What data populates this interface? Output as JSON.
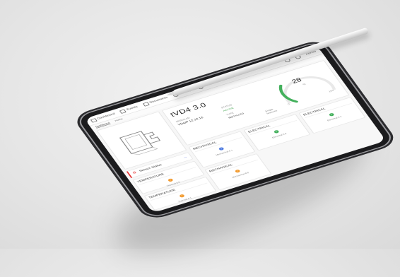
{
  "topbar": {
    "nav": [
      "Dashboard",
      "Events",
      "Documents",
      "Settings",
      "More information"
    ],
    "user": "Admin"
  },
  "subnav": [
    "Dashboard",
    "Home"
  ],
  "machine": {
    "name": "tVD4 3.0",
    "label_a": "SERIAL/ID",
    "value_a": "VD4/P 12.12.16",
    "label_b": "STATUS",
    "value_b": "ACTIVE",
    "label_c": "TYPE",
    "value_c": "INSTALLED",
    "right_note": "Single features"
  },
  "gauge": {
    "value": "28",
    "unit": "%",
    "min": "0",
    "max": "100",
    "fraction": 0.28
  },
  "sensor": {
    "label": "Sensor Status"
  },
  "tiles": [
    {
      "name": "TEMPERATURE",
      "color": "orange",
      "value": "Thermal 0.0"
    },
    {
      "name": "MECHANICAL",
      "color": "blue",
      "value": "Mechanical 0.1"
    },
    {
      "name": "ELECTRICAL",
      "color": "green",
      "value": "Electrical 0.0"
    },
    {
      "name": "TEMPERATURE",
      "color": "orange",
      "value": "Thermal 0.1"
    },
    {
      "name": "MECHANICAL",
      "color": "orange",
      "value": "Mechanical 0.0"
    },
    {
      "name": "ELECTRICAL",
      "color": "green",
      "value": "Electrical 0.1"
    }
  ],
  "colors": {
    "accent": "#43b05c",
    "alert": "#e43a3a",
    "warn": "#f29a2e",
    "link": "#4f7be0"
  }
}
